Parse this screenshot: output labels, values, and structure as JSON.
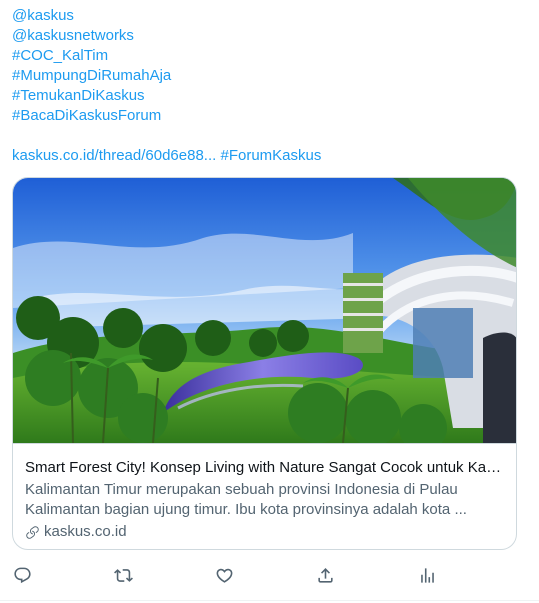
{
  "tweet": {
    "tags": [
      "@kaskus",
      "@kaskusnetworks",
      "#COC_KalTim",
      "#MumpungDiRumahAja",
      "#TemukanDiKaskus",
      "#BacaDiKaskusForum"
    ],
    "link_text": "kaskus.co.id/thread/60d6e88...",
    "link_hashtag": "#ForumKaskus"
  },
  "card": {
    "title": "Smart Forest City! Konsep Living with Nature Sangat Cocok untuk Kali...",
    "description": "Kalimantan Timur merupakan sebuah provinsi Indonesia di Pulau Kalimantan bagian ujung timur. Ibu kota provinsinya adalah kota ...",
    "domain": "kaskus.co.id",
    "domain_icon": "link-icon"
  },
  "actions": [
    {
      "name": "reply",
      "icon": "reply-icon"
    },
    {
      "name": "retweet",
      "icon": "retweet-icon"
    },
    {
      "name": "like",
      "icon": "heart-icon"
    },
    {
      "name": "share",
      "icon": "share-icon"
    },
    {
      "name": "analytics",
      "icon": "analytics-icon"
    }
  ],
  "colors": {
    "link": "#1d9bf0",
    "text": "#0f1419",
    "muted": "#536471",
    "border": "#cfd9de"
  }
}
